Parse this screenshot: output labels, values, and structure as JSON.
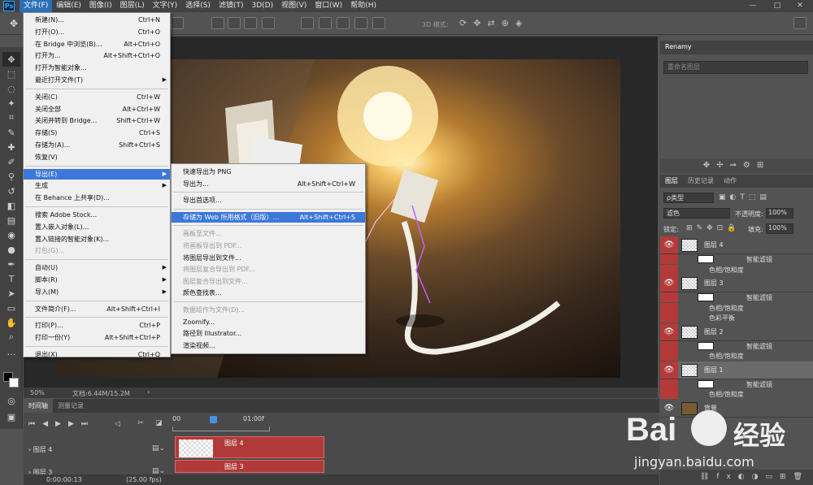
{
  "menubar": {
    "logo": "Ps",
    "items": [
      "文件(F)",
      "编辑(E)",
      "图像(I)",
      "图层(L)",
      "文字(Y)",
      "选择(S)",
      "滤镜(T)",
      "3D(D)",
      "视图(V)",
      "窗口(W)",
      "帮助(H)"
    ],
    "window_controls": [
      "—",
      "□",
      "✕"
    ]
  },
  "optbar": {
    "mode_3d": "3D 模式:"
  },
  "status": {
    "zoom": "50%",
    "doc": "文档:6.44M/15.2M"
  },
  "file_menu": {
    "items": [
      {
        "label": "新建(N)...",
        "shortcut": "Ctrl+N"
      },
      {
        "label": "打开(O)...",
        "shortcut": "Ctrl+O"
      },
      {
        "label": "在 Bridge 中浏览(B)...",
        "shortcut": "Alt+Ctrl+O"
      },
      {
        "label": "打开为...",
        "shortcut": "Alt+Shift+Ctrl+O"
      },
      {
        "label": "打开为智能对象...",
        "shortcut": ""
      },
      {
        "label": "最近打开文件(T)",
        "shortcut": "",
        "submenu": true
      },
      {
        "label": "关闭(C)",
        "shortcut": "Ctrl+W"
      },
      {
        "label": "关闭全部",
        "shortcut": "Alt+Ctrl+W"
      },
      {
        "label": "关闭并转到 Bridge...",
        "shortcut": "Shift+Ctrl+W"
      },
      {
        "label": "存储(S)",
        "shortcut": "Ctrl+S"
      },
      {
        "label": "存储为(A)...",
        "shortcut": "Shift+Ctrl+S"
      },
      {
        "label": "恢复(V)",
        "shortcut": ""
      },
      {
        "label": "导出(E)",
        "shortcut": "",
        "submenu": true,
        "highlight": true
      },
      {
        "label": "生成",
        "shortcut": "",
        "submenu": true
      },
      {
        "label": "在 Behance 上共享(D)...",
        "shortcut": ""
      },
      {
        "label": "搜索 Adobe Stock...",
        "shortcut": ""
      },
      {
        "label": "置入嵌入对象(L)...",
        "shortcut": ""
      },
      {
        "label": "置入链接的智能对象(K)...",
        "shortcut": ""
      },
      {
        "label": "打包(G)...",
        "shortcut": "",
        "disabled": true
      },
      {
        "label": "自动(U)",
        "shortcut": "",
        "submenu": true
      },
      {
        "label": "脚本(R)",
        "shortcut": "",
        "submenu": true
      },
      {
        "label": "导入(M)",
        "shortcut": "",
        "submenu": true
      },
      {
        "label": "文件简介(F)...",
        "shortcut": "Alt+Shift+Ctrl+I"
      },
      {
        "label": "打印(P)...",
        "shortcut": "Ctrl+P"
      },
      {
        "label": "打印一份(Y)",
        "shortcut": "Alt+Shift+Ctrl+P"
      },
      {
        "label": "退出(X)",
        "shortcut": "Ctrl+Q"
      }
    ]
  },
  "export_menu": {
    "items": [
      {
        "label": "快速导出为 PNG",
        "shortcut": ""
      },
      {
        "label": "导出为...",
        "shortcut": "Alt+Shift+Ctrl+W"
      },
      {
        "label": "导出首选项...",
        "shortcut": ""
      },
      {
        "label": "存储为 Web 所用格式（旧版）...",
        "shortcut": "Alt+Shift+Ctrl+S",
        "highlight": true
      },
      {
        "label": "画板至文件...",
        "shortcut": "",
        "disabled": true
      },
      {
        "label": "将画板导出到 PDF...",
        "shortcut": "",
        "disabled": true
      },
      {
        "label": "将图层导出到文件...",
        "shortcut": ""
      },
      {
        "label": "将图层复合导出到 PDF...",
        "shortcut": "",
        "disabled": true
      },
      {
        "label": "图层复合导出到文件...",
        "shortcut": "",
        "disabled": true
      },
      {
        "label": "颜色查找表...",
        "shortcut": ""
      },
      {
        "label": "数据组作为文件(D)...",
        "shortcut": "",
        "disabled": true
      },
      {
        "label": "Zoomify...",
        "shortcut": ""
      },
      {
        "label": "路径到 Illustrator...",
        "shortcut": ""
      },
      {
        "label": "渲染视频...",
        "shortcut": ""
      }
    ]
  },
  "renamy": {
    "title": "Renamy",
    "placeholder": "重命名图层"
  },
  "layers_panel": {
    "tabs": [
      "图层",
      "历史记录",
      "动作"
    ],
    "kind": "ρ类型",
    "blend": "滤色",
    "opacity_label": "不透明度:",
    "opacity": "100%",
    "lock_label": "锁定:",
    "fill_label": "填充:",
    "fill": "100%",
    "layers": [
      {
        "name": "图层 4",
        "subs": [
          "智能滤镜",
          "色相/饱和度"
        ]
      },
      {
        "name": "图层 3",
        "subs": [
          "智能滤镜",
          "色相/饱和度",
          "色彩平衡"
        ]
      },
      {
        "name": "图层 2",
        "subs": [
          "智能滤镜",
          "色相/饱和度"
        ]
      },
      {
        "name": "图层 1",
        "subs": [
          "智能滤镜",
          "色相/饱和度"
        ]
      },
      {
        "name": "背景",
        "subs": []
      }
    ]
  },
  "timeline": {
    "tabs": [
      "时间轴",
      "测量记录"
    ],
    "ruler_start": "00",
    "ruler_mark": "01:00f",
    "tracks": [
      "图层 4",
      "图层 3"
    ],
    "timecode": "0:00:00:13",
    "fps": "(25.00 fps)"
  },
  "watermark": {
    "brand": "Bai",
    "brand2": "经验",
    "url": "jingyan.baidu.com"
  }
}
